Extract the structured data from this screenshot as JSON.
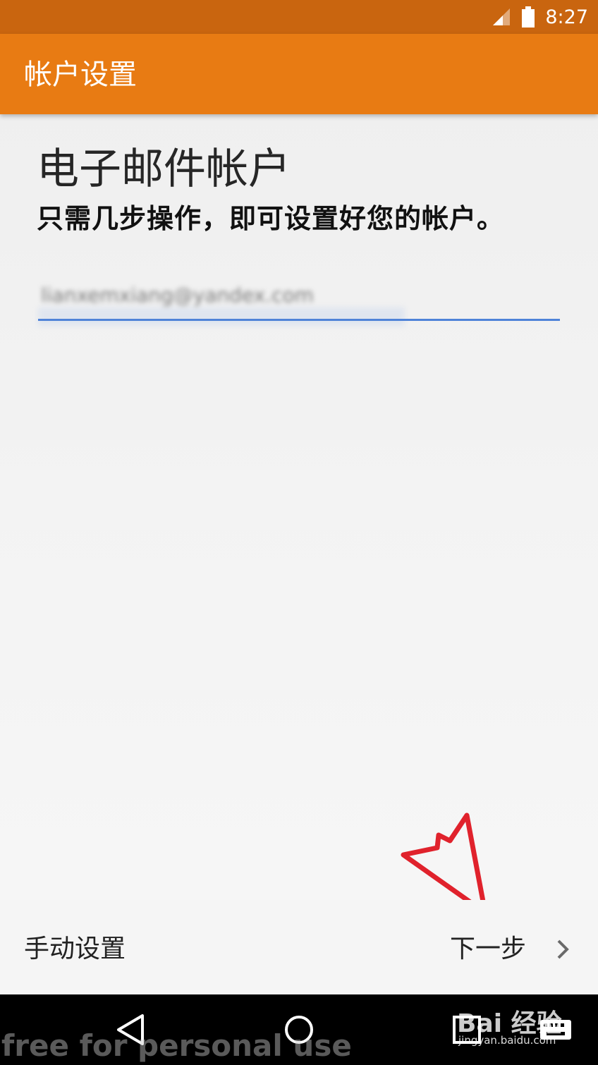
{
  "status_bar": {
    "time": "8:27",
    "icons": [
      "cellular-signal-icon",
      "battery-icon"
    ]
  },
  "app_bar": {
    "title": "帐户设置",
    "color": "#e87b13",
    "status_color": "#c9650f"
  },
  "main": {
    "title": "电子邮件帐户",
    "subtitle": "只需几步操作，即可设置好您的帐户。",
    "email_field": {
      "value": "lianxemxiang@yandex.com",
      "underline_color": "#4f83d8"
    }
  },
  "footer": {
    "manual_setup_label": "手动设置",
    "next_label": "下一步",
    "next_icon": "chevron-right-icon"
  },
  "nav_bar": {
    "buttons": [
      "back-icon",
      "home-icon",
      "recents-icon",
      "keyboard-icon"
    ]
  },
  "overlay": {
    "watermark": "free for personal use",
    "logo_text": "Bai 经验",
    "logo_url_text": "jingyan.baidu.com",
    "arrow_color": "#e0222c"
  }
}
